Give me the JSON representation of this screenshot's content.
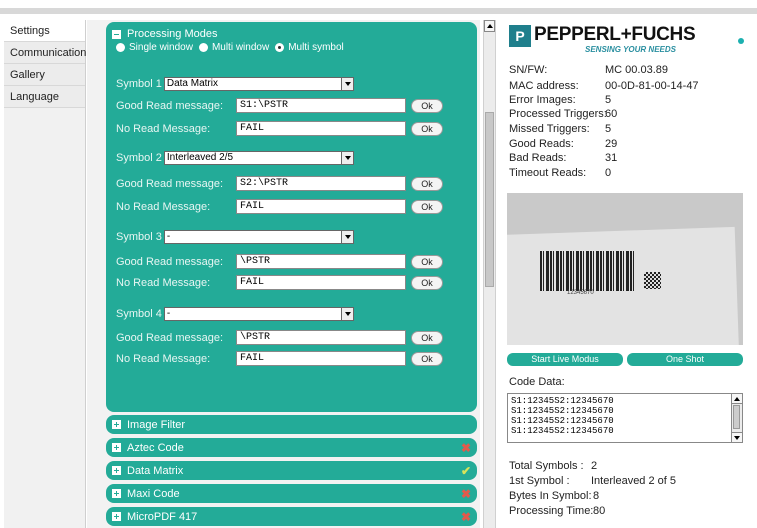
{
  "nav": {
    "items": [
      "Settings",
      "Communication",
      "Gallery",
      "Language"
    ]
  },
  "processing": {
    "title": "Processing Modes",
    "modes": [
      "Single window",
      "Multi window",
      "Multi symbol"
    ],
    "selected_mode": "Multi symbol",
    "symbols": [
      {
        "label": "Symbol 1",
        "type": "Data Matrix",
        "good_label": "Good Read message:",
        "good_value": "S1:\\PSTR",
        "no_label": "No Read Message:",
        "no_value": "FAIL",
        "ok": "Ok"
      },
      {
        "label": "Symbol 2",
        "type": "Interleaved 2/5",
        "good_label": "Good Read message:",
        "good_value": "S2:\\PSTR",
        "no_label": "No Read Message:",
        "no_value": "FAIL",
        "ok": "Ok"
      },
      {
        "label": "Symbol 3",
        "type": "-",
        "good_label": "Good Read message:",
        "good_value": "\\PSTR",
        "no_label": "No Read Message:",
        "no_value": "FAIL",
        "ok": "Ok"
      },
      {
        "label": "Symbol 4",
        "type": "-",
        "good_label": "Good Read message:",
        "good_value": "\\PSTR",
        "no_label": "No Read Message:",
        "no_value": "FAIL",
        "ok": "Ok"
      }
    ]
  },
  "accordions": [
    {
      "label": "Image Filter",
      "status": ""
    },
    {
      "label": "Aztec Code",
      "status": "✖"
    },
    {
      "label": "Data Matrix",
      "status": "✔"
    },
    {
      "label": "Maxi Code",
      "status": "✖"
    },
    {
      "label": "MicroPDF 417",
      "status": "✖"
    }
  ],
  "brand": {
    "mark": "P",
    "name": "PEPPERL+FUCHS",
    "tagline": "SENSING YOUR NEEDS"
  },
  "device_info": [
    {
      "key": "SN/FW:",
      "value": "MC 00.03.89"
    },
    {
      "key": "MAC address:",
      "value": "00-0D-81-00-14-47"
    },
    {
      "key": "Error Images:",
      "value": "5"
    },
    {
      "key": "Processed Triggers:",
      "value": "60"
    },
    {
      "key": "Missed Triggers:",
      "value": "5"
    },
    {
      "key": "Good Reads:",
      "value": "29"
    },
    {
      "key": "Bad Reads:",
      "value": "31"
    },
    {
      "key": "Timeout Reads:",
      "value": "0"
    }
  ],
  "camera": {
    "barcode_text": "12345670"
  },
  "buttons": {
    "live": "Start Live Modus",
    "shot": "One Shot"
  },
  "code": {
    "label": "Code Data:",
    "lines": [
      "S1:12345S2:12345670",
      "S1:12345S2:12345670",
      "S1:12345S2:12345670",
      "S1:12345S2:12345670"
    ]
  },
  "summary": [
    {
      "key": "Total Symbols :",
      "value": "2"
    },
    {
      "key": "1st Symbol :",
      "value": "Interleaved 2 of 5"
    },
    {
      "key": "Bytes In Symbol:",
      "value": "8"
    },
    {
      "key": "Processing Time:",
      "value": "80"
    }
  ],
  "colors": {
    "accent": "#23ab98",
    "brand": "#1f7f8c",
    "error": "#e25a4b",
    "ok": "#d6e35a"
  }
}
